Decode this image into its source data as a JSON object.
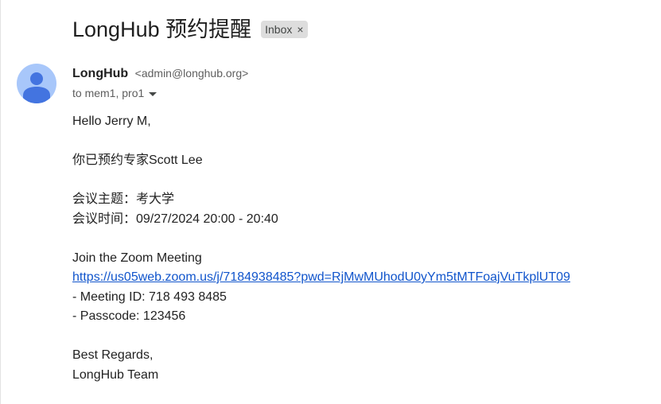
{
  "email": {
    "subject": "LongHub 预约提醒",
    "label": {
      "text": "Inbox",
      "close_glyph": "×"
    },
    "sender": {
      "name": "LongHub",
      "email": "<admin@longhub.org>",
      "avatar_icon": "person-icon",
      "avatar_bg": "#a8c7fa",
      "avatar_fg": "#4374e0"
    },
    "recipients": "to mem1, pro1",
    "body": {
      "greeting": "Hello Jerry M,",
      "booked": "你已预约专家Scott Lee",
      "topic": "会议主题：考大学",
      "time": "会议时间：09/27/2024 20:00 - 20:40",
      "join": "Join the Zoom Meeting",
      "link": "https://us05web.zoom.us/j/7184938485?pwd=RjMwMUhodU0yYm5tMTFoajVuTkplUT09",
      "meeting_id": "- Meeting ID: 718 493 8485",
      "passcode": "- Passcode: 123456",
      "closing": "Best Regards,",
      "signature": "LongHub Team"
    },
    "colors": {
      "link": "#1155cc",
      "chip_bg": "#dddddd"
    }
  }
}
